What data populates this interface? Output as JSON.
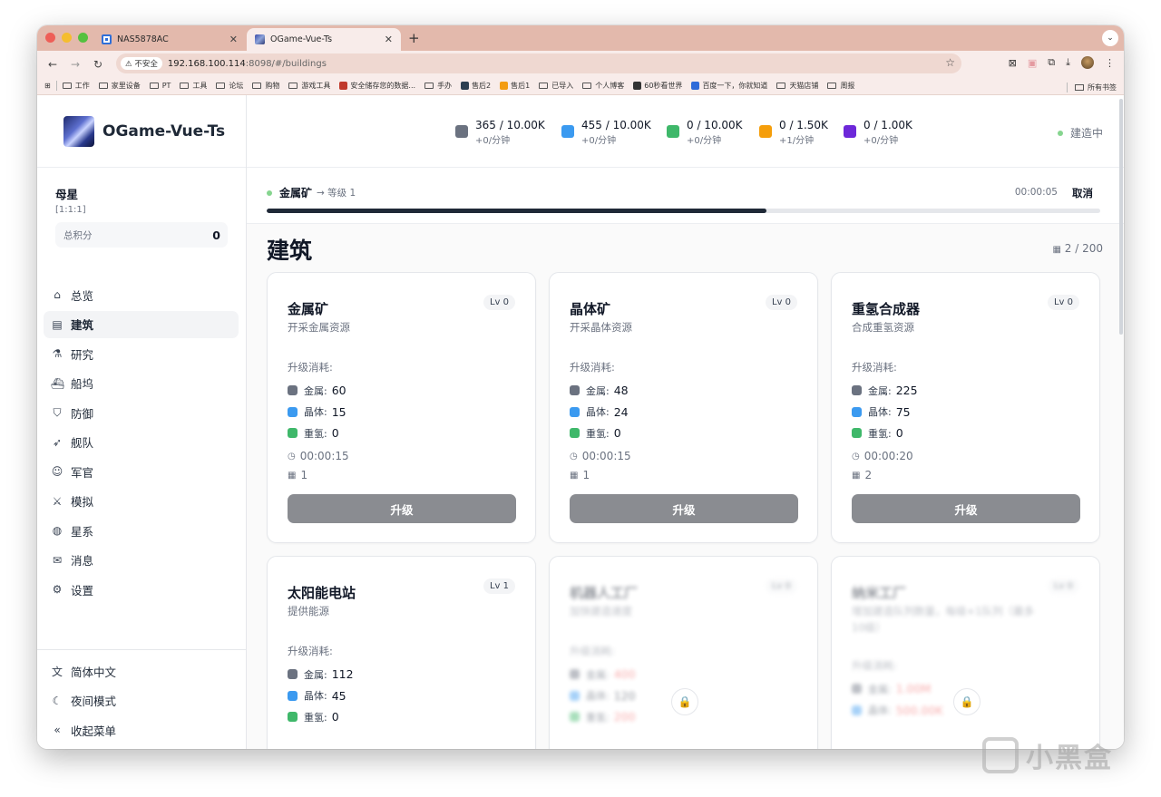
{
  "browser": {
    "tabs": [
      {
        "title": "NAS5878AC"
      },
      {
        "title": "OGame-Vue-Ts"
      }
    ],
    "security_label": "不安全",
    "url_host": "192.168.100.114",
    "url_rest": ":8098/#/buildings",
    "bookmarks": [
      "工作",
      "家里设备",
      "PT",
      "工具",
      "论坛",
      "购物",
      "游戏工具",
      "安全储存您的数据...",
      "手办",
      "售后2",
      "售后1",
      "已导入",
      "个人博客",
      "60秒看世界",
      "百度一下，你就知道",
      "天猫店铺",
      "周报"
    ],
    "all_bookmarks": "所有书签"
  },
  "app": {
    "brand": "OGame-Vue-Ts",
    "planet": {
      "name": "母星",
      "coords": "[1:1:1]",
      "score_label": "总积分",
      "score": "0"
    },
    "menu": [
      {
        "label": "总览",
        "icon": "home-icon"
      },
      {
        "label": "建筑",
        "icon": "building-icon"
      },
      {
        "label": "研究",
        "icon": "flask-icon"
      },
      {
        "label": "船坞",
        "icon": "ship-icon"
      },
      {
        "label": "防御",
        "icon": "shield-icon"
      },
      {
        "label": "舰队",
        "icon": "rocket-icon"
      },
      {
        "label": "军官",
        "icon": "users-icon"
      },
      {
        "label": "模拟",
        "icon": "swords-icon"
      },
      {
        "label": "星系",
        "icon": "globe-icon"
      },
      {
        "label": "消息",
        "icon": "mail-icon"
      },
      {
        "label": "设置",
        "icon": "gear-icon"
      }
    ],
    "bottom_menu": [
      {
        "label": "简体中文",
        "icon": "language-icon"
      },
      {
        "label": "夜间模式",
        "icon": "moon-icon"
      },
      {
        "label": "收起菜单",
        "icon": "collapse-icon"
      }
    ]
  },
  "resources": [
    {
      "amount": "365 / 10.00K",
      "rate": "+0/分钟",
      "color": "#6b7280"
    },
    {
      "amount": "455 / 10.00K",
      "rate": "+0/分钟",
      "color": "#3b9af0"
    },
    {
      "amount": "0 / 10.00K",
      "rate": "+0/分钟",
      "color": "#3fb86a"
    },
    {
      "amount": "0 / 1.50K",
      "rate": "+1/分钟",
      "color": "#f59e0b"
    },
    {
      "amount": "0 / 1.00K",
      "rate": "+0/分钟",
      "color": "#6d28d9"
    }
  ],
  "building_status": "建造中",
  "queue": {
    "name": "金属矿",
    "level": "→ 等级 1",
    "time": "00:00:05",
    "cancel": "取消",
    "progress": 0.6
  },
  "page": {
    "title": "建筑",
    "slots": "2 / 200"
  },
  "cost_title": "升级消耗:",
  "res_labels": {
    "metal": "金属:",
    "crystal": "晶体:",
    "deut": "重氢:"
  },
  "upgrade_label": "升级",
  "cards": [
    {
      "name": "金属矿",
      "desc": "开采金属资源",
      "level": "Lv 0",
      "metal": "60",
      "crystal": "15",
      "deut": "0",
      "time": "00:00:15",
      "slots": "1"
    },
    {
      "name": "晶体矿",
      "desc": "开采晶体资源",
      "level": "Lv 0",
      "metal": "48",
      "crystal": "24",
      "deut": "0",
      "time": "00:00:15",
      "slots": "1"
    },
    {
      "name": "重氢合成器",
      "desc": "合成重氢资源",
      "level": "Lv 0",
      "metal": "225",
      "crystal": "75",
      "deut": "0",
      "time": "00:00:20",
      "slots": "2"
    },
    {
      "name": "太阳能电站",
      "desc": "提供能源",
      "level": "Lv 1",
      "metal": "112",
      "crystal": "45",
      "deut": "0"
    },
    {
      "name": "机器人工厂",
      "desc": "加快建造速度",
      "level": "Lv 0",
      "metal": "400",
      "crystal": "120",
      "deut": "200"
    },
    {
      "name": "纳米工厂",
      "desc": "增加建造队列数量，每级+1队列（最多10级）",
      "level": "Lv 0",
      "metal": "1.00M",
      "crystal": "500.00K"
    }
  ],
  "watermark": "小黑盒",
  "colors": {
    "metal": "#6b7280",
    "crystal": "#3b9af0",
    "deut": "#3fb86a",
    "accent": "#1f2937",
    "button": "#8a8c91"
  }
}
